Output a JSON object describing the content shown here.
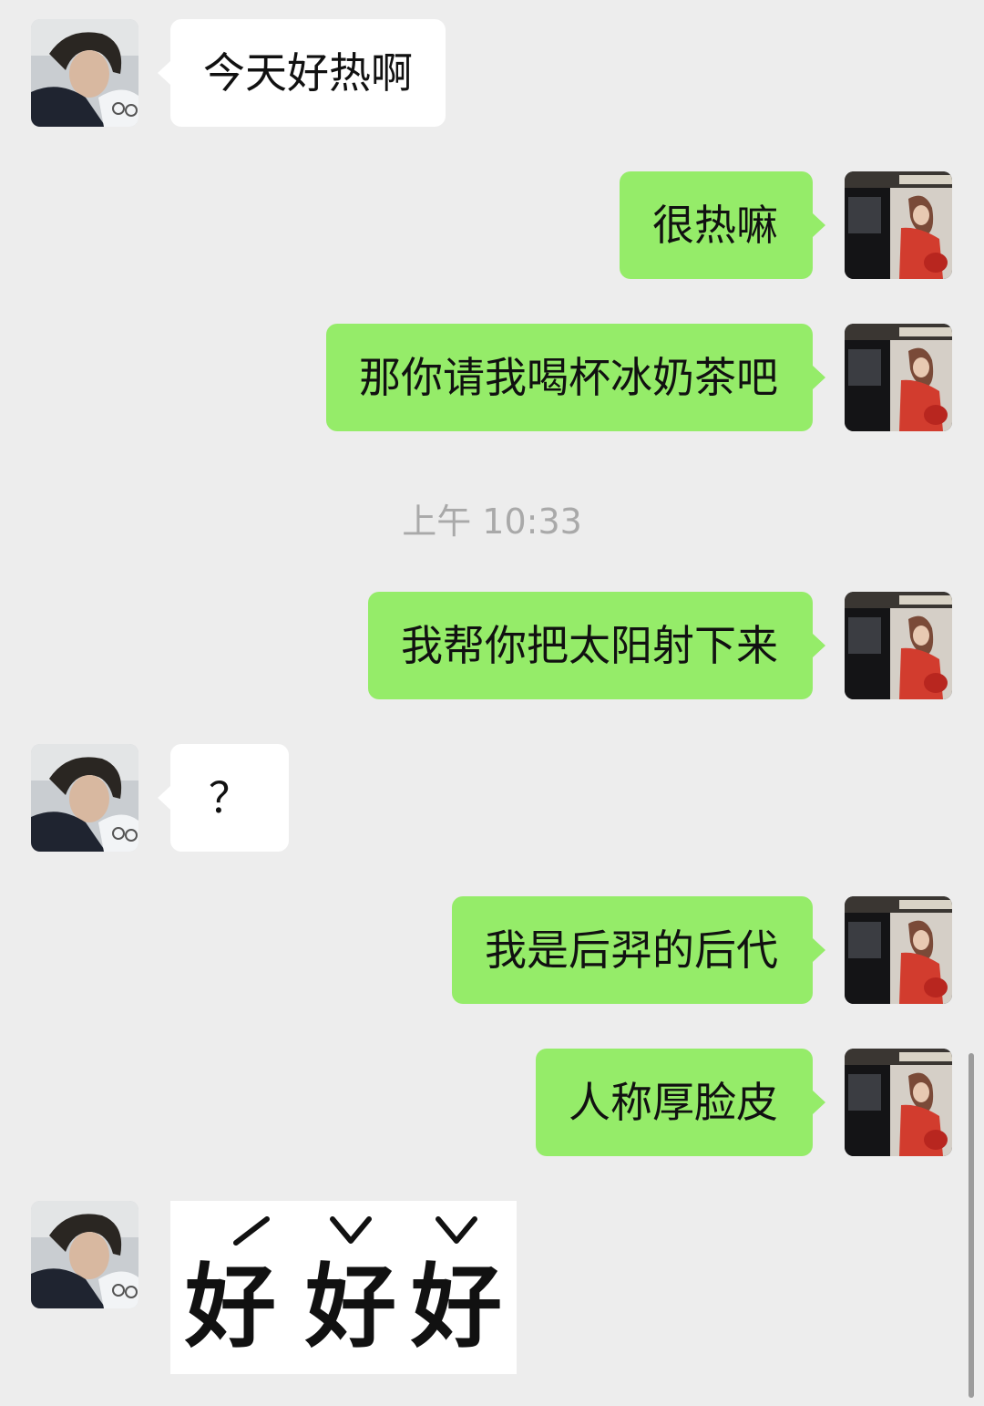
{
  "messages": [
    {
      "side": "in",
      "text": "今天好热啊"
    },
    {
      "side": "out",
      "text": "很热嘛"
    },
    {
      "side": "out",
      "text": "那你请我喝杯冰奶茶吧"
    },
    {
      "side": "out",
      "text": "我帮你把太阳射下来"
    },
    {
      "side": "in",
      "text": "？"
    },
    {
      "side": "out",
      "text": "我是后羿的后代"
    },
    {
      "side": "out",
      "text": "人称厚脸皮"
    }
  ],
  "timestamp": "上午 10:33",
  "sticker": {
    "chars": [
      "好",
      "好",
      "好"
    ],
    "tones": [
      "rising",
      "dipping",
      "dipping"
    ]
  },
  "colors": {
    "background": "#ededed",
    "incoming_bubble": "#ffffff",
    "outgoing_bubble": "#95ec69",
    "timestamp_text": "#a9a9a9"
  },
  "icons": {
    "contact_avatar": "contact-avatar-photo",
    "self_avatar": "self-avatar-photo"
  }
}
